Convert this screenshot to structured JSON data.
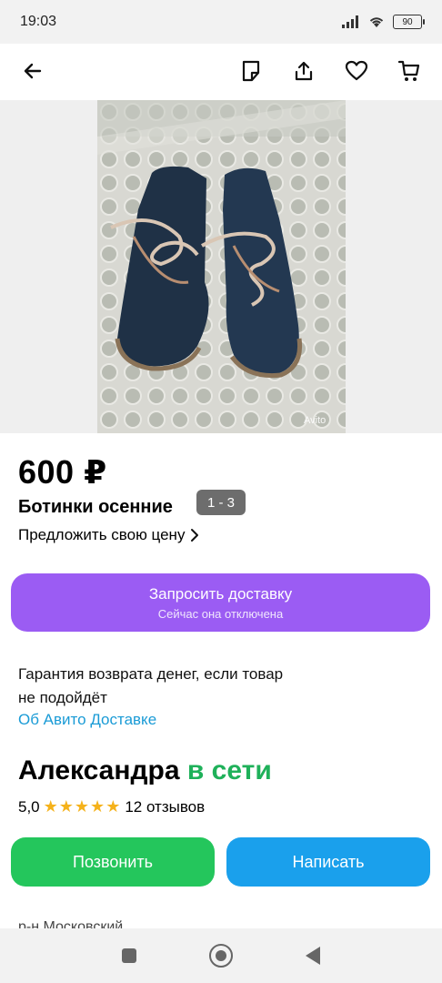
{
  "status_bar": {
    "time": "19:03",
    "battery": "90"
  },
  "toolbar": {
    "back_icon": "arrow-left-icon",
    "icons": [
      "note-icon",
      "share-icon",
      "heart-icon",
      "cart-icon"
    ]
  },
  "gallery": {
    "pager": "1 - 3",
    "watermark": "Avito"
  },
  "listing": {
    "price": "600 ₽",
    "title": "Ботинки осенние",
    "offer_price": "Предложить свою цену"
  },
  "delivery": {
    "button_label": "Запросить доставку",
    "button_sub": "Сейчас она отключена",
    "guarantee_line1": "Гарантия возврата денег, если товар",
    "guarantee_line2": "не подойдёт",
    "link": "Об Авито Доставке"
  },
  "seller": {
    "name": "Александра",
    "status": "в сети",
    "rating": "5,0",
    "reviews": "12 отзывов"
  },
  "actions": {
    "call": "Позвонить",
    "write": "Написать"
  },
  "address_partial": "р-н Московский",
  "colors": {
    "delivery_button": "#9b5cf3",
    "call_button": "#24c65c",
    "write_button": "#1aa0ec",
    "link": "#1a9bd6",
    "online": "#1fb15a",
    "stars": "#f5b21b"
  }
}
